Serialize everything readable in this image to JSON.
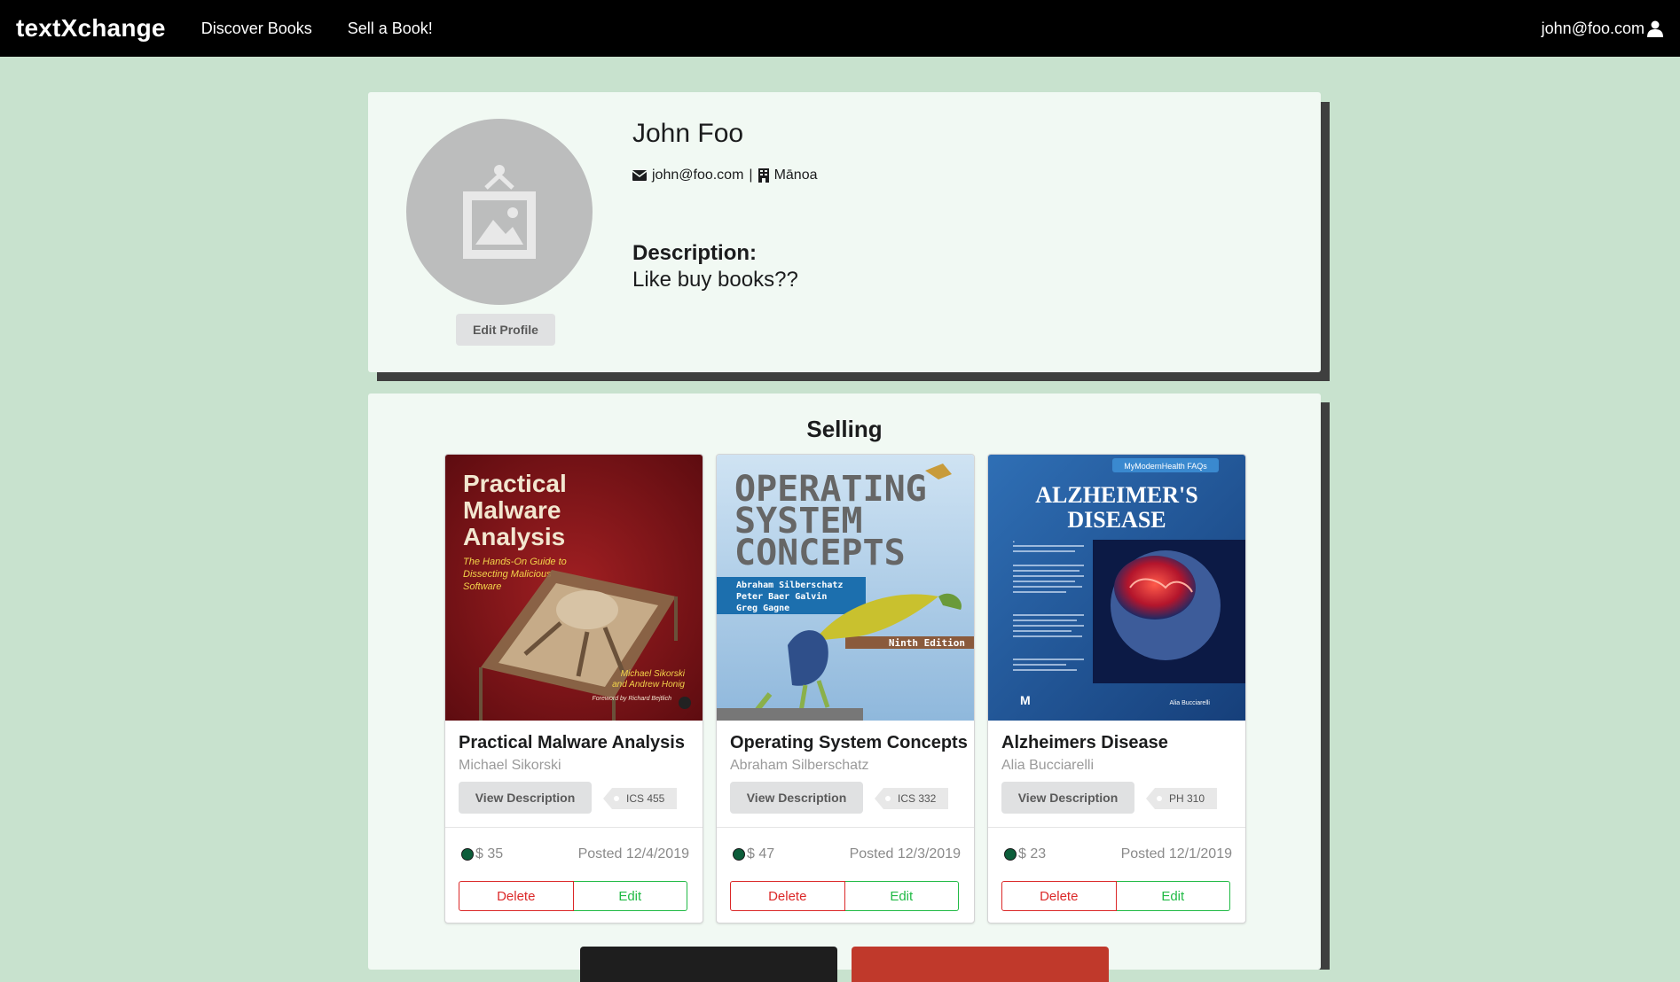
{
  "nav": {
    "brand": "textXchange",
    "links": [
      "Discover Books",
      "Sell a Book!"
    ],
    "user_email": "john@foo.com"
  },
  "profile": {
    "name": "John Foo",
    "email": "john@foo.com",
    "separator": "|",
    "campus": "Mānoa",
    "description_label": "Description:",
    "description": "Like buy books??",
    "edit_button": "Edit Profile"
  },
  "selling": {
    "title": "Selling",
    "cards": [
      {
        "title": "Practical Malware Analysis",
        "author": "Michael Sikorski",
        "view_button": "View Description",
        "course": "ICS 455",
        "price": "$ 35",
        "posted": "Posted 12/4/2019",
        "delete": "Delete",
        "edit": "Edit",
        "cover": {
          "line1": "Practical",
          "line2": "Malware",
          "line3": "Analysis",
          "subtitle1": "The Hands-On Guide to",
          "subtitle2": "Dissecting Malicious",
          "subtitle3": "Software",
          "authors1": "Michael Sikorski",
          "authors2": "and Andrew Honig",
          "foreword": "Foreword by Richard Bejtlich"
        }
      },
      {
        "title": "Operating System Concepts",
        "author": "Abraham Silberschatz",
        "view_button": "View Description",
        "course": "ICS 332",
        "price": "$ 47",
        "posted": "Posted 12/3/2019",
        "delete": "Delete",
        "edit": "Edit",
        "cover": {
          "line1": "OPERATING",
          "line2": "SYSTEM",
          "line3": "CONCEPTS",
          "author1": "Abraham Silberschatz",
          "author2": "Peter Baer Galvin",
          "author3": "Greg Gagne",
          "edition": "Ninth Edition"
        }
      },
      {
        "title": "Alzheimers Disease",
        "author": "Alia Bucciarelli",
        "view_button": "View Description",
        "course": "PH 310",
        "price": "$ 23",
        "posted": "Posted 12/1/2019",
        "delete": "Delete",
        "edit": "Edit",
        "cover": {
          "series": "MyModernHealth FAQs",
          "line1": "ALZHEIMER'S",
          "line2": "DISEASE",
          "bullet1": "Easy to follow, question-and-answer format",
          "bullet2": "Includes companion disc with figures from the book and additional resources and links from major health facilities and organizations",
          "bullet3": "Cites numerous in-text Web links to information at National Institutes of Health, FDA, and other online sources",
          "bullet4": "Up-to-date treatments and recent drug information",
          "author": "Alia Bucciarelli"
        }
      }
    ]
  },
  "colors": {
    "page_bg": "#c8e2ce",
    "nav_bg": "#000000",
    "panel_bg": "#f1f9f3",
    "delete": "#db2828",
    "edit": "#21ba45",
    "status_dot": "#0c5d3a"
  }
}
